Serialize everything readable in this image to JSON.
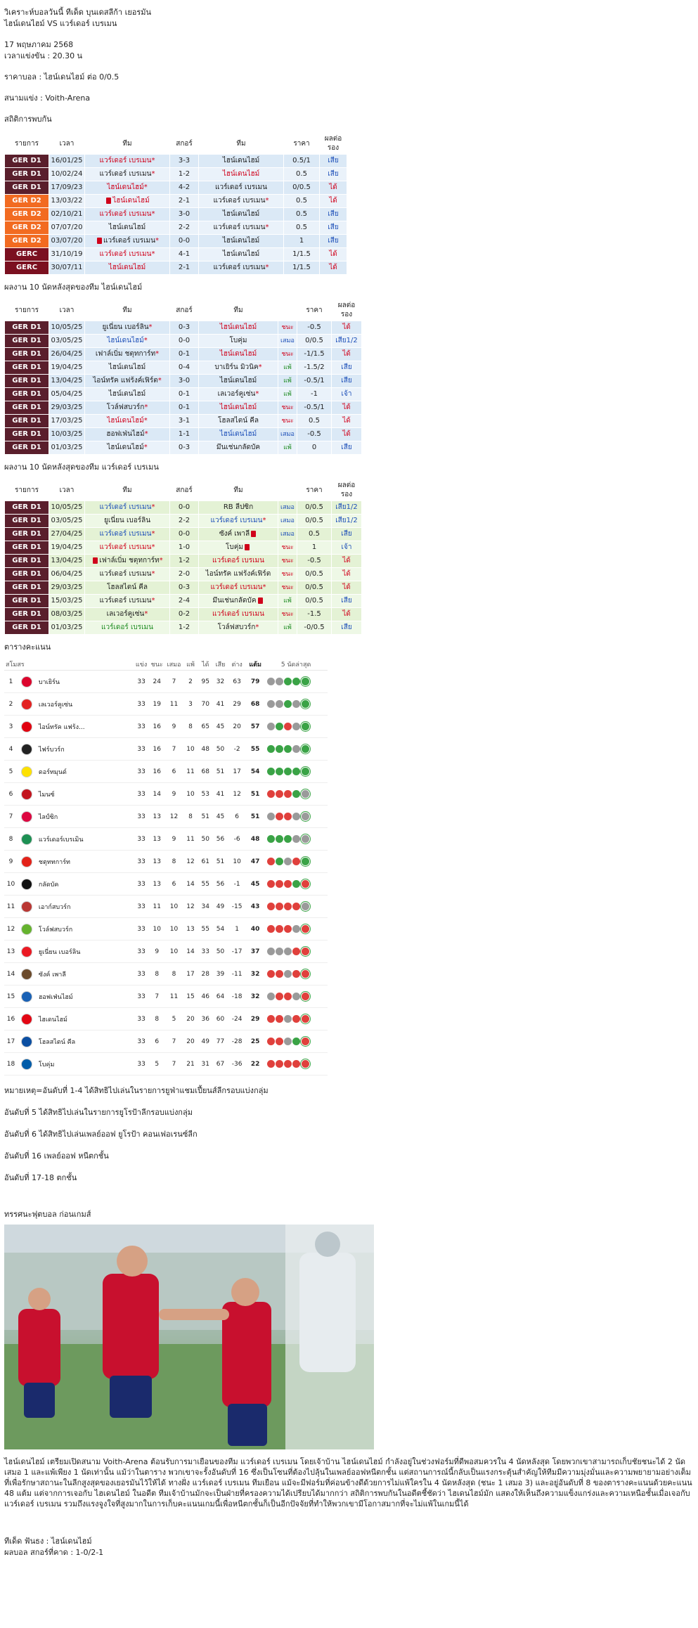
{
  "header": {
    "title1": "วิเคราะห์บอลวันนี้ ทีเด็ด บุนเดสลีก้า เยอรมัน",
    "title2": "ไฮน์เดนไฮม์ VS แวร์เดอร์ เบรเมน",
    "date": "17 พฤษภาคม 2568",
    "kickoff": "เวลาแข่งขัน : 20.30 น",
    "odds": "ราคาบอล : ไฮน์เดนไฮม์ ต่อ 0/0.5",
    "venue": "สนามแข่ง : Voith-Arena",
    "h2h_title": "สถิติการพบกัน"
  },
  "cols": {
    "league": "รายการ",
    "time": "เวลา",
    "team": "ทีม",
    "score": "สกอร์",
    "odds": "ราคา",
    "result": "ผลต่อรอง"
  },
  "h2h": [
    {
      "lg": "GER D1",
      "cls": "gerd1",
      "d": "16/01/25",
      "h": "แวร์เดอร์ เบรเมน",
      "hs": "red",
      "ha": "*",
      "s": "3-3",
      "a": "ไฮน์เดนไฮม์",
      "as": "dark",
      "o": "0.5/1",
      "r": "เสีย",
      "rc": "blue"
    },
    {
      "lg": "GER D1",
      "cls": "gerd1",
      "d": "10/02/24",
      "h": "แวร์เดอร์ เบรเมน",
      "hs": "dark",
      "ha": "*",
      "s": "1-2",
      "a": "ไฮน์เดนไฮม์",
      "as": "red",
      "o": "0.5",
      "r": "เสีย",
      "rc": "blue"
    },
    {
      "lg": "GER D1",
      "cls": "gerd1",
      "d": "17/09/23",
      "h": "ไฮน์เดนไฮม์",
      "hs": "red",
      "ha": "*",
      "s": "4-2",
      "a": "แวร์เดอร์ เบรเมน",
      "as": "dark",
      "o": "0/0.5",
      "r": "ได้",
      "rc": "red"
    },
    {
      "lg": "GER D2",
      "cls": "gerd2",
      "d": "13/03/22",
      "h": "ไฮน์เดนไฮม์",
      "hs": "red",
      "ha": "",
      "card": true,
      "s": "2-1",
      "a": "แวร์เดอร์ เบรเมน",
      "as": "dark",
      "aa": "*",
      "o": "0.5",
      "r": "ได้",
      "rc": "red"
    },
    {
      "lg": "GER D2",
      "cls": "gerd2",
      "d": "02/10/21",
      "h": "แวร์เดอร์ เบรเมน",
      "hs": "red",
      "ha": "*",
      "s": "3-0",
      "a": "ไฮน์เดนไฮม์",
      "as": "dark",
      "o": "0.5",
      "r": "เสีย",
      "rc": "blue"
    },
    {
      "lg": "GER D2",
      "cls": "gerd2",
      "d": "07/07/20",
      "h": "ไฮน์เดนไฮม์",
      "hs": "dark",
      "ha": "",
      "s": "2-2",
      "a": "แวร์เดอร์ เบรเมน",
      "as": "dark",
      "aa": "*",
      "o": "0.5",
      "r": "เสีย",
      "rc": "blue"
    },
    {
      "lg": "GER D2",
      "cls": "gerd2",
      "d": "03/07/20",
      "h": "แวร์เดอร์ เบรเมน",
      "hs": "dark",
      "ha": "*",
      "card": true,
      "s": "0-0",
      "a": "ไฮน์เดนไฮม์",
      "as": "dark",
      "o": "1",
      "r": "เสีย",
      "rc": "blue"
    },
    {
      "lg": "GERC",
      "cls": "gerc",
      "d": "31/10/19",
      "h": "แวร์เดอร์ เบรเมน",
      "hs": "red",
      "ha": "*",
      "s": "4-1",
      "a": "ไฮน์เดนไฮม์",
      "as": "dark",
      "o": "1/1.5",
      "r": "ได้",
      "rc": "red"
    },
    {
      "lg": "GERC",
      "cls": "gerc",
      "d": "30/07/11",
      "h": "ไฮน์เดนไฮม์",
      "hs": "red",
      "ha": "",
      "s": "2-1",
      "a": "แวร์เดอร์ เบรเมน",
      "as": "dark",
      "aa": "*",
      "o": "1/1.5",
      "r": "ได้",
      "rc": "red"
    }
  ],
  "home_title": "ผลงาน 10 นัดหลังสุดของทีม ไฮน์เดนไฮม์",
  "home": [
    {
      "d": "10/05/25",
      "h": "ยูเนี่ยน เบอร์ลิน",
      "hs": "dark",
      "ha": "*",
      "s": "0-3",
      "a": "ไฮน์เดนไฮม์",
      "as": "red",
      "w": "ชนะ",
      "wc": "red",
      "o": "-0.5",
      "r": "ได้",
      "rc": "red"
    },
    {
      "d": "03/05/25",
      "h": "ไฮน์เดนไฮม์",
      "hs": "blue",
      "ha": "*",
      "s": "0-0",
      "a": "โบคุ่ม",
      "as": "dark",
      "w": "เสมอ",
      "wc": "blue",
      "o": "0/0.5",
      "r": "เสีย1/2",
      "rc": "blue"
    },
    {
      "d": "26/04/25",
      "h": "เฟาล์เบิ่ม ชตุทการ์ท",
      "hs": "dark",
      "ha": "*",
      "s": "0-1",
      "a": "ไฮน์เดนไฮม์",
      "as": "red",
      "w": "ชนะ",
      "wc": "red",
      "o": "-1/1.5",
      "r": "ได้",
      "rc": "red"
    },
    {
      "d": "19/04/25",
      "h": "ไฮน์เดนไฮม์",
      "hs": "dark",
      "ha": "",
      "s": "0-4",
      "a": "บาเยิร์น มิวนิค",
      "as": "dark",
      "aa": "*",
      "w": "แพ้",
      "wc": "green",
      "o": "-1.5/2",
      "r": "เสีย",
      "rc": "blue"
    },
    {
      "d": "13/04/25",
      "h": "ไอน์ทรัค แฟร้งค์เฟิร์ต",
      "hs": "dark",
      "ha": "*",
      "s": "3-0",
      "a": "ไฮน์เดนไฮม์",
      "as": "dark",
      "w": "แพ้",
      "wc": "green",
      "o": "-0.5/1",
      "r": "เสีย",
      "rc": "blue"
    },
    {
      "d": "05/04/25",
      "h": "ไฮน์เดนไฮม์",
      "hs": "dark",
      "ha": "",
      "s": "0-1",
      "a": "เลเวอร์คูเซ่น",
      "as": "dark",
      "aa": "*",
      "w": "แพ้",
      "wc": "green",
      "o": "-1",
      "r": "เจ้า",
      "rc": "blue"
    },
    {
      "d": "29/03/25",
      "h": "โวล์ฟสบวร์ก",
      "hs": "dark",
      "ha": "*",
      "s": "0-1",
      "a": "ไฮน์เดนไฮม์",
      "as": "red",
      "w": "ชนะ",
      "wc": "red",
      "o": "-0.5/1",
      "r": "ได้",
      "rc": "red"
    },
    {
      "d": "17/03/25",
      "h": "ไฮน์เดนไฮม์",
      "hs": "red",
      "ha": "*",
      "s": "3-1",
      "a": "โฮลสไตน์ คีล",
      "as": "dark",
      "w": "ชนะ",
      "wc": "red",
      "o": "0.5",
      "r": "ได้",
      "rc": "red"
    },
    {
      "d": "10/03/25",
      "h": "ฮอฟเฟ่นไฮม์",
      "hs": "dark",
      "ha": "*",
      "s": "1-1",
      "a": "ไฮน์เดนไฮม์",
      "as": "blue",
      "w": "เสมอ",
      "wc": "blue",
      "o": "-0.5",
      "r": "ได้",
      "rc": "red"
    },
    {
      "d": "01/03/25",
      "h": "ไฮน์เดนไฮม์",
      "hs": "dark",
      "ha": "*",
      "s": "0-3",
      "a": "มึนเช่นกลัดบัค",
      "as": "dark",
      "w": "แพ้",
      "wc": "green",
      "o": "0",
      "r": "เสีย",
      "rc": "blue"
    }
  ],
  "away_title": "ผลงาน 10 นัดหลังสุดของทีม แวร์เดอร์ เบรเมน",
  "away": [
    {
      "d": "10/05/25",
      "h": "แวร์เดอร์ เบรเมน",
      "hs": "blue",
      "ha": "*",
      "s": "0-0",
      "a": "RB ลีปซิก",
      "as": "dark",
      "w": "เสมอ",
      "wc": "blue",
      "o": "0/0.5",
      "r": "เสีย1/2",
      "rc": "blue"
    },
    {
      "d": "03/05/25",
      "h": "ยูเนี่ยน เบอร์ลิน",
      "hs": "dark",
      "ha": "",
      "s": "2-2",
      "a": "แวร์เดอร์ เบรเมน",
      "as": "blue",
      "aa": "*",
      "w": "เสมอ",
      "wc": "blue",
      "o": "0/0.5",
      "r": "เสีย1/2",
      "rc": "blue"
    },
    {
      "d": "27/04/25",
      "h": "แวร์เดอร์ เบรเมน",
      "hs": "blue",
      "ha": "*",
      "s": "0-0",
      "a": "ซังค์ เพาลี",
      "as": "dark",
      "acard": true,
      "w": "เสมอ",
      "wc": "blue",
      "o": "0.5",
      "r": "เสีย",
      "rc": "blue"
    },
    {
      "d": "19/04/25",
      "h": "แวร์เดอร์ เบรเมน",
      "hs": "red",
      "ha": "*",
      "s": "1-0",
      "a": "โบคุ่ม",
      "as": "dark",
      "acard": true,
      "w": "ชนะ",
      "wc": "red",
      "o": "1",
      "r": "เจ้า",
      "rc": "blue"
    },
    {
      "d": "13/04/25",
      "h": "เฟาล์เบิ่ม ชตุทการ์ท",
      "hs": "dark",
      "ha": "*",
      "card": true,
      "s": "1-2",
      "a": "แวร์เดอร์ เบรเมน",
      "as": "red",
      "w": "ชนะ",
      "wc": "red",
      "o": "-0.5",
      "r": "ได้",
      "rc": "red"
    },
    {
      "d": "06/04/25",
      "h": "แวร์เดอร์ เบรเมน",
      "hs": "dark",
      "ha": "*",
      "s": "2-0",
      "a": "ไอน์ทรัค แฟร้งค์เฟิร์ต",
      "as": "dark",
      "w": "ชนะ",
      "wc": "red",
      "o": "0/0.5",
      "r": "ได้",
      "rc": "red"
    },
    {
      "d": "29/03/25",
      "h": "โฮลสไตน์ คีล",
      "hs": "dark",
      "ha": "",
      "s": "0-3",
      "a": "แวร์เดอร์ เบรเมน",
      "as": "red",
      "aa": "*",
      "w": "ชนะ",
      "wc": "red",
      "o": "0/0.5",
      "r": "ได้",
      "rc": "red"
    },
    {
      "d": "15/03/25",
      "h": "แวร์เดอร์ เบรเมน",
      "hs": "dark",
      "ha": "*",
      "s": "2-4",
      "a": "มึนเช่นกลัดบัค",
      "as": "dark",
      "acard": true,
      "w": "แพ้",
      "wc": "green",
      "o": "0/0.5",
      "r": "เสีย",
      "rc": "blue"
    },
    {
      "d": "08/03/25",
      "h": "เลเวอร์คูเซ่น",
      "hs": "dark",
      "ha": "*",
      "s": "0-2",
      "a": "แวร์เดอร์ เบรเมน",
      "as": "red",
      "w": "ชนะ",
      "wc": "red",
      "o": "-1.5",
      "r": "ได้",
      "rc": "red"
    },
    {
      "d": "01/03/25",
      "h": "แวร์เดอร์ เบรเมน",
      "hs": "green",
      "ha": "",
      "s": "1-2",
      "a": "โวล์ฟสบวร์ก",
      "as": "dark",
      "aa": "*",
      "w": "แพ้",
      "wc": "green",
      "o": "-0/0.5",
      "r": "เสีย",
      "rc": "blue"
    }
  ],
  "standings_title": "ตารางคะแนน",
  "st_cols": {
    "team": "สโมสร",
    "p": "แข่ง",
    "w": "ชนะ",
    "d": "เสมอ",
    "l": "แพ้",
    "f": "ได้",
    "a": "เสีย",
    "gd": "ต่าง",
    "pts": "แต้ม",
    "form": "5 นัดล่าสุด"
  },
  "standings": [
    {
      "pos": "1",
      "team": "บาเยิร์น",
      "c": "#dc052d",
      "p": "33",
      "w": "24",
      "d": "7",
      "l": "2",
      "f": "95",
      "a": "32",
      "gd": "63",
      "pts": "79",
      "form": "ddwww"
    },
    {
      "pos": "2",
      "team": "เลเวอร์คูเซ่น",
      "c": "#e32221",
      "p": "33",
      "w": "19",
      "d": "11",
      "l": "3",
      "f": "70",
      "a": "41",
      "gd": "29",
      "pts": "68",
      "form": "ddwdw"
    },
    {
      "pos": "3",
      "team": "ไอน์ทรัค แฟร้ง...",
      "c": "#e1000f",
      "p": "33",
      "w": "16",
      "d": "9",
      "l": "8",
      "f": "65",
      "a": "45",
      "gd": "20",
      "pts": "57",
      "form": "dwldw"
    },
    {
      "pos": "4",
      "team": "ไฟร์บวร์ก",
      "c": "#222222",
      "p": "33",
      "w": "16",
      "d": "7",
      "l": "10",
      "f": "48",
      "a": "50",
      "gd": "-2",
      "pts": "55",
      "form": "wwwdw"
    },
    {
      "pos": "5",
      "team": "ดอร์ทมุนด์",
      "c": "#fde100",
      "p": "33",
      "w": "16",
      "d": "6",
      "l": "11",
      "f": "68",
      "a": "51",
      "gd": "17",
      "pts": "54",
      "form": "wwwww"
    },
    {
      "pos": "6",
      "team": "ไมนซ์",
      "c": "#c3141e",
      "p": "33",
      "w": "14",
      "d": "9",
      "l": "10",
      "f": "53",
      "a": "41",
      "gd": "12",
      "pts": "51",
      "form": "lllwd"
    },
    {
      "pos": "7",
      "team": "ไลป์ซิก",
      "c": "#dd0741",
      "p": "33",
      "w": "13",
      "d": "12",
      "l": "8",
      "f": "51",
      "a": "45",
      "gd": "6",
      "pts": "51",
      "form": "dlldd"
    },
    {
      "pos": "8",
      "team": "แวร์เดอร์เบรเมิน",
      "c": "#1d9053",
      "p": "33",
      "w": "13",
      "d": "9",
      "l": "11",
      "f": "50",
      "a": "56",
      "gd": "-6",
      "pts": "48",
      "form": "wwwdd"
    },
    {
      "pos": "9",
      "team": "ชตุททการ์ท",
      "c": "#e32219",
      "p": "33",
      "w": "13",
      "d": "8",
      "l": "12",
      "f": "61",
      "a": "51",
      "gd": "10",
      "pts": "47",
      "form": "lwdlw"
    },
    {
      "pos": "10",
      "team": "กลัดบัค",
      "c": "#111111",
      "p": "33",
      "w": "13",
      "d": "6",
      "l": "14",
      "f": "55",
      "a": "56",
      "gd": "-1",
      "pts": "45",
      "form": "lllwl"
    },
    {
      "pos": "11",
      "team": "เอาก์สบวร์ก",
      "c": "#ba3733",
      "p": "33",
      "w": "11",
      "d": "10",
      "l": "12",
      "f": "34",
      "a": "49",
      "gd": "-15",
      "pts": "43",
      "form": "lllld"
    },
    {
      "pos": "12",
      "team": "โวล์ฟสบวร์ก",
      "c": "#65b32e",
      "p": "33",
      "w": "10",
      "d": "10",
      "l": "13",
      "f": "55",
      "a": "54",
      "gd": "1",
      "pts": "40",
      "form": "llldl"
    },
    {
      "pos": "13",
      "team": "ยูเนี่ยน เบอร์ลิน",
      "c": "#eb1923",
      "p": "33",
      "w": "9",
      "d": "10",
      "l": "14",
      "f": "33",
      "a": "50",
      "gd": "-17",
      "pts": "37",
      "form": "dddll"
    },
    {
      "pos": "14",
      "team": "ซังค์ เพาลี",
      "c": "#6b4a2b",
      "p": "33",
      "w": "8",
      "d": "8",
      "l": "17",
      "f": "28",
      "a": "39",
      "gd": "-11",
      "pts": "32",
      "form": "lldll"
    },
    {
      "pos": "15",
      "team": "ฮอฟเฟ่นไฮม์",
      "c": "#1961b5",
      "p": "33",
      "w": "7",
      "d": "11",
      "l": "15",
      "f": "46",
      "a": "64",
      "gd": "-18",
      "pts": "32",
      "form": "dlldl"
    },
    {
      "pos": "16",
      "team": "ไฮเดนไฮม์",
      "c": "#e30613",
      "p": "33",
      "w": "8",
      "d": "5",
      "l": "20",
      "f": "36",
      "a": "60",
      "gd": "-24",
      "pts": "29",
      "form": "lldll"
    },
    {
      "pos": "17",
      "team": "โฮลสไตน์ คีล",
      "c": "#0b4fa2",
      "p": "33",
      "w": "6",
      "d": "7",
      "l": "20",
      "f": "49",
      "a": "77",
      "gd": "-28",
      "pts": "25",
      "form": "lldwl"
    },
    {
      "pos": "18",
      "team": "โบคุ่ม",
      "c": "#005ca9",
      "p": "33",
      "w": "5",
      "d": "7",
      "l": "21",
      "f": "31",
      "a": "67",
      "gd": "-36",
      "pts": "22",
      "form": "lllll"
    }
  ],
  "notes": [
    "หมายเหตุ=อันดับที่ 1-4 ได้สิทธิไปเล่นในรายการยูฟ่าแชมเปี้ยนส์ลีกรอบแบ่งกลุ่ม",
    "อันดับที่ 5 ได้สิทธิไปเล่นในรายการยูโรป้าลีกรอบแบ่งกลุ่ม",
    "อันดับที่ 6 ได้สิทธิไปเล่นเพลย์ออฟ ยูโรป้า คอนเฟอเรนซ์ลีก",
    "อันดับที่ 16 เพลย์ออฟ หนีตกชั้น",
    "อันดับที่ 17-18 ตกชั้น"
  ],
  "preview_title": "ทรรศนะฟุตบอล ก่อนเกมส์",
  "article": "ไฮน์เดนไฮม์ เตรียมเปิดสนาม Voith-Arena ต้อนรับการมาเยือนของทีม แวร์เดอร์ เบรเมน โดยเจ้าบ้าน ไฮน์เดนไฮม์ กำลังอยู่ในช่วงฟอร์มที่ดีพอสมควรใน 4 นัดหลังสุด โดยพวกเขาสามารถเก็บชัยชนะได้ 2 นัด เสมอ 1 และแพ้เพียง 1 นัดเท่านั้น แม้ว่าในตาราง พวกเขาจะรั้งอันดับที่ 16 ซึ่งเป็นโซนที่ต้องไปลุ้นในเพลย์ออฟหนีตกชั้น แต่สถานการณ์นี้กลับเป็นแรงกระตุ้นสำคัญให้ทีมมีความมุ่งมั่นและความพยายามอย่างเต็มที่เพื่อรักษาสถานะในลีกสูงสุดของเยอรมันไว้ให้ได้ ทางฝั่ง แวร์เดอร์ เบรเมน ทีมเยือน แม้จะมีฟอร์มที่ค่อนข้างดีด้วยการไม่แพ้ใครใน 4 นัดหลังสุด (ชนะ 1 เสมอ 3) และอยู่อันดับที่ 8 ของตารางคะแนนด้วยคะแนน 48 แต้ม แต่จากการเจอกับ ไฮเดนไฮม์ ในอดีต ทีมเจ้าบ้านมักจะเป็นฝ่ายที่ครองความได้เปรียบได้มากกว่า สถิติการพบกันในอดีตชี้ชัดว่า ไฮเดนไฮม์มัก แสดงให้เห็นถึงความแข็งแกร่งและความเหนือชั้นเมื่อเจอกับ แวร์เดอร์ เบรเมน รวมถึงแรงจูงใจที่สูงมากในการเก็บคะแนนเกมนี้เพื่อหนีตกชั้นก็เป็นอีกปัจจัยที่ทำให้พวกเขามีโอกาสมากที่จะไม่แพ้ในเกมนี้ได้",
  "tip": "ทีเด็ด ฟันธง : ไฮน์เดนไฮม์",
  "score_pred": "ผลบอล สกอร์ที่คาด : 1-0/2-1",
  "league_home": "GER D1"
}
